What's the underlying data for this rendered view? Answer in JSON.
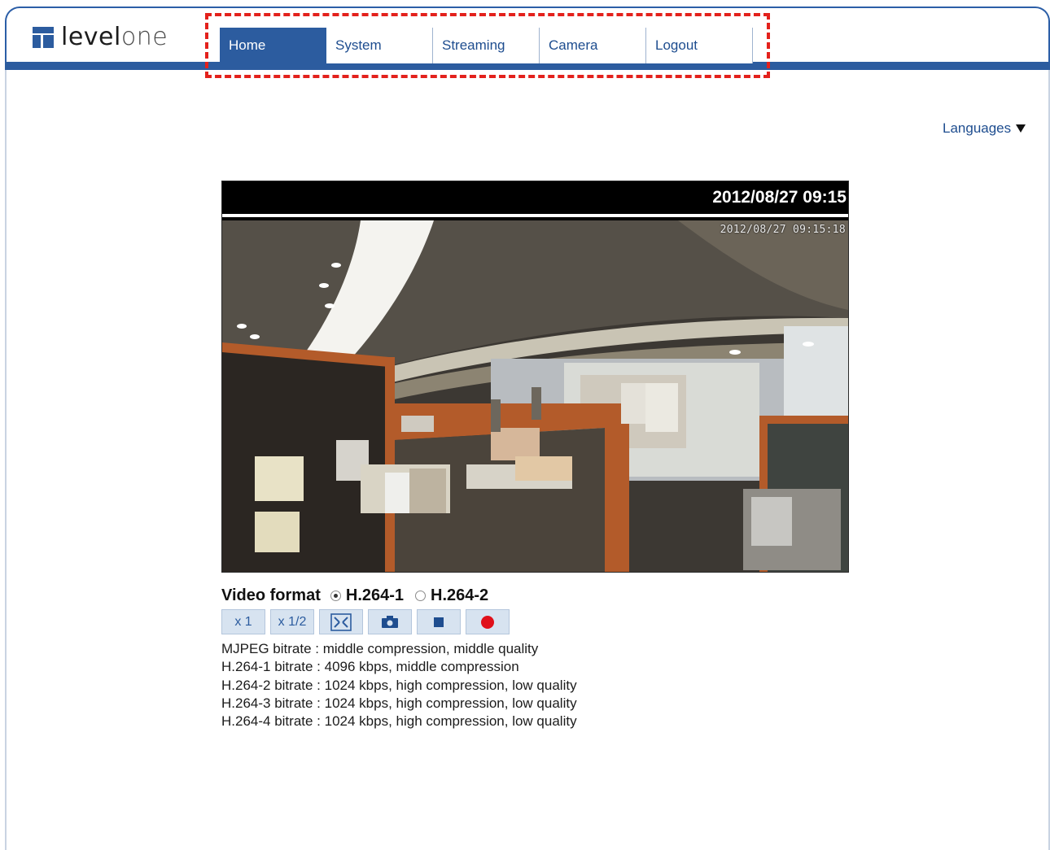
{
  "brand": {
    "logo_text_a": "level",
    "logo_text_b": "one"
  },
  "nav": {
    "items": [
      {
        "label": "Home",
        "active": true
      },
      {
        "label": "System",
        "active": false
      },
      {
        "label": "Streaming",
        "active": false
      },
      {
        "label": "Camera",
        "active": false
      },
      {
        "label": "Logout",
        "active": false
      }
    ]
  },
  "languages": {
    "label": "Languages"
  },
  "viewer": {
    "timestamp": "2012/08/27 09:15",
    "overlay_timestamp": "2012/08/27 09:15:18"
  },
  "format": {
    "label": "Video format",
    "options": [
      {
        "label": "H.264-1",
        "selected": true
      },
      {
        "label": "H.264-2",
        "selected": false
      }
    ]
  },
  "controls": {
    "zoom_x1": "x 1",
    "zoom_half": "x 1/2",
    "fullscreen_icon": "fullscreen-icon",
    "snapshot_icon": "camera-icon",
    "stop_icon": "stop-icon",
    "record_icon": "record-icon"
  },
  "bitrates": [
    "MJPEG bitrate : middle compression, middle quality",
    "H.264-1 bitrate : 4096 kbps, middle compression",
    "H.264-2 bitrate : 1024 kbps, high compression, low quality",
    "H.264-3 bitrate : 1024 kbps, high compression, low quality",
    "H.264-4 bitrate : 1024 kbps, high compression, low quality"
  ],
  "colors": {
    "brand_blue": "#2c5c9f",
    "highlight_red": "#e3211c",
    "record_red": "#e0101a"
  }
}
